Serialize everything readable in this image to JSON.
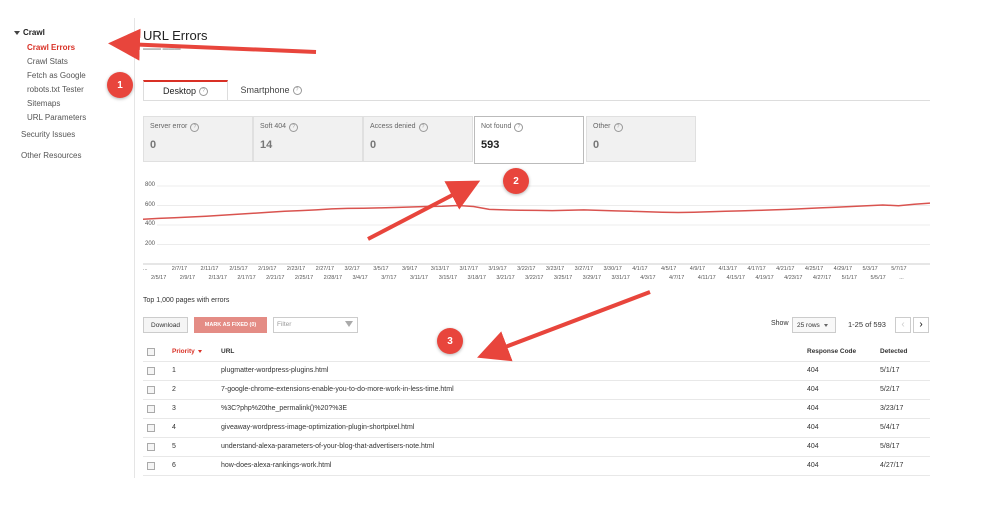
{
  "sidebar": {
    "group_label": "Crawl",
    "items": [
      {
        "label": "Crawl Errors",
        "active": true
      },
      {
        "label": "Crawl Stats"
      },
      {
        "label": "Fetch as Google"
      },
      {
        "label": "robots.txt Tester"
      },
      {
        "label": "Sitemaps"
      },
      {
        "label": "URL Parameters"
      }
    ],
    "top_items": [
      "Security Issues",
      "Other Resources"
    ]
  },
  "page": {
    "title": "URL Errors"
  },
  "tabs": [
    {
      "label": "Desktop",
      "active": true
    },
    {
      "label": "Smartphone"
    }
  ],
  "stats": [
    {
      "label": "Server error",
      "value": "0"
    },
    {
      "label": "Soft 404",
      "value": "14"
    },
    {
      "label": "Access denied",
      "value": "0"
    },
    {
      "label": "Not found",
      "value": "593",
      "selected": true
    },
    {
      "label": "Other",
      "value": "0"
    }
  ],
  "chart_data": {
    "type": "line",
    "y_ticks": [
      "800",
      "600",
      "400",
      "200"
    ],
    "ylim": [
      0,
      800
    ],
    "x_ticks_top": [
      "...",
      "2/7/17",
      "2/11/17",
      "2/15/17",
      "2/19/17",
      "2/23/17",
      "2/27/17",
      "3/2/17",
      "3/5/17",
      "3/9/17",
      "3/13/17",
      "3/17/17",
      "3/19/17",
      "3/22/17",
      "3/23/17",
      "3/27/17",
      "3/30/17",
      "4/1/17",
      "4/5/17",
      "4/9/17",
      "4/13/17",
      "4/17/17",
      "4/21/17",
      "4/25/17",
      "4/29/17",
      "5/3/17",
      "5/7/17"
    ],
    "x_ticks_bottom": [
      "2/5/17",
      "2/9/17",
      "2/13/17",
      "2/17/17",
      "2/21/17",
      "2/25/17",
      "2/28/17",
      "3/4/17",
      "3/7/17",
      "3/11/17",
      "3/15/17",
      "3/18/17",
      "3/21/17",
      "3/22/17",
      "3/25/17",
      "3/29/17",
      "3/31/17",
      "4/3/17",
      "4/7/17",
      "4/11/17",
      "4/15/17",
      "4/19/17",
      "4/23/17",
      "4/27/17",
      "5/1/17",
      "5/5/17",
      "..."
    ],
    "series": [
      {
        "color": "#d9534f",
        "values": [
          460,
          468,
          475,
          482,
          490,
          500,
          510,
          520,
          530,
          540,
          548,
          555,
          565,
          570,
          572,
          575,
          580,
          585,
          590,
          592,
          600,
          590,
          560,
          555,
          552,
          550,
          548,
          552,
          555,
          550,
          545,
          540,
          535,
          530,
          528,
          530,
          535,
          540,
          545,
          550,
          555,
          560,
          568,
          575,
          582,
          590,
          598,
          605,
          598,
          612,
          625
        ]
      }
    ],
    "grid": true
  },
  "table_section": {
    "title": "Top 1,000 pages with errors",
    "download_label": "Download",
    "mark_fixed_label": "MARK AS FIXED (0)",
    "filter_placeholder": "Filter",
    "show_label": "Show",
    "rows_select": "25 rows",
    "range_label": "1-25 of 593",
    "prev_icon": "‹",
    "next_icon": "›",
    "columns": {
      "priority": "Priority",
      "url": "URL",
      "code": "Response Code",
      "detected": "Detected"
    },
    "rows": [
      {
        "priority": "1",
        "url": "plugmatter-wordpress-plugins.html",
        "code": "404",
        "detected": "5/1/17"
      },
      {
        "priority": "2",
        "url": "7-google-chrome-extensions-enable-you-to-do-more-work-in-less-time.html",
        "code": "404",
        "detected": "5/2/17"
      },
      {
        "priority": "3",
        "url": "%3C?php%20the_permalink()%20?%3E",
        "code": "404",
        "detected": "3/23/17"
      },
      {
        "priority": "4",
        "url": "giveaway-wordpress-image-optimization-plugin-shortpixel.html",
        "code": "404",
        "detected": "5/4/17"
      },
      {
        "priority": "5",
        "url": "understand-alexa-parameters-of-your-blog-that-advertisers-note.html",
        "code": "404",
        "detected": "5/8/17"
      },
      {
        "priority": "6",
        "url": "how-does-alexa-rankings-work.html",
        "code": "404",
        "detected": "4/27/17"
      }
    ]
  },
  "callouts": [
    "1",
    "2",
    "3"
  ],
  "colors": {
    "accent": "#d93025",
    "annotation": "#e8453c",
    "line": "#d9534f"
  }
}
